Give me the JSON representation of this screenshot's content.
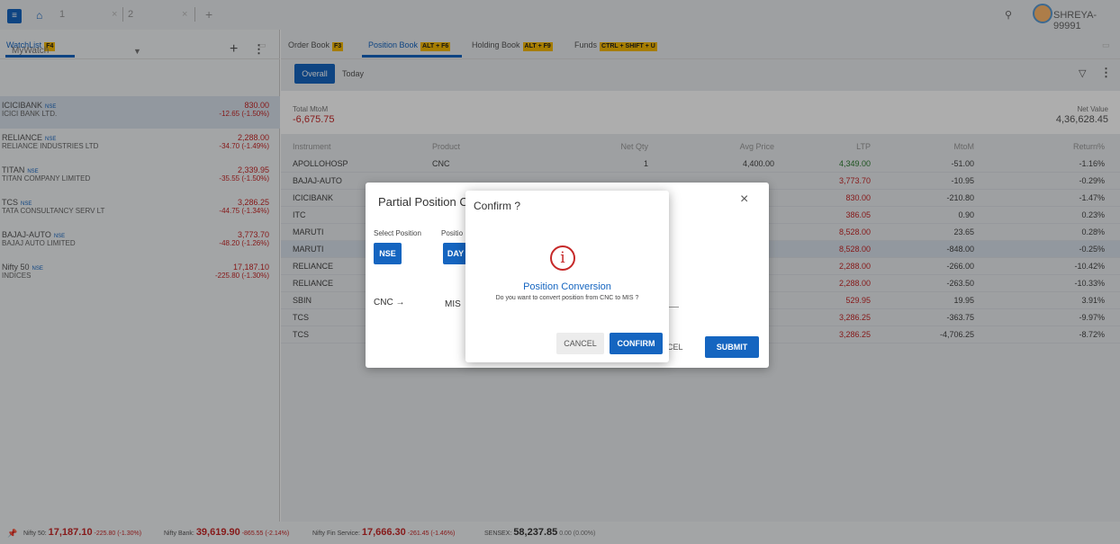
{
  "topbar": {
    "tabs": [
      "1",
      "2"
    ],
    "close": "×",
    "plus": "+",
    "user": "SHREYA-99991"
  },
  "watchlist": {
    "title": "WatchList",
    "badge": "F4",
    "name": "MyWatch",
    "plus": "+",
    "dots": "⋮",
    "items": [
      {
        "sym": "ICICIBANK",
        "ex": "NSE",
        "full": "ICICI BANK LTD.",
        "price": "830.00",
        "chg": "-12.65 (-1.50%)"
      },
      {
        "sym": "RELIANCE",
        "ex": "NSE",
        "full": "RELIANCE INDUSTRIES LTD",
        "price": "2,288.00",
        "chg": "-34.70 (-1.49%)"
      },
      {
        "sym": "TITAN",
        "ex": "NSE",
        "full": "TITAN COMPANY LIMITED",
        "price": "2,339.95",
        "chg": "-35.55 (-1.50%)"
      },
      {
        "sym": "TCS",
        "ex": "NSE",
        "full": "TATA CONSULTANCY SERV LT",
        "price": "3,286.25",
        "chg": "-44.75 (-1.34%)"
      },
      {
        "sym": "BAJAJ-AUTO",
        "ex": "NSE",
        "full": "BAJAJ AUTO LIMITED",
        "price": "3,773.70",
        "chg": "-48.20 (-1.26%)"
      },
      {
        "sym": "Nifty 50",
        "ex": "NSE",
        "full": "INDICES",
        "price": "17,187.10",
        "chg": "-225.80 (-1.30%)"
      }
    ]
  },
  "tabs": [
    {
      "label": "Order Book",
      "badge": "F3"
    },
    {
      "label": "Position Book",
      "badge": "ALT + F6"
    },
    {
      "label": "Holding Book",
      "badge": "ALT + F9"
    },
    {
      "label": "Funds",
      "badge": "CTRL + SHIFT + U"
    }
  ],
  "filters": {
    "overall": "Overall",
    "today": "Today"
  },
  "summary": {
    "mtm_label": "Total MtoM",
    "mtm_value": "-6,675.75",
    "nv_label": "Net Value",
    "nv_value": "4,36,628.45"
  },
  "table": {
    "headers": [
      "Instrument",
      "Product",
      "Net Qty",
      "Avg Price",
      "LTP",
      "MtoM",
      "Return%"
    ],
    "rows": [
      [
        "APOLLOHOSP",
        "CNC",
        "1",
        "4,400.00",
        "4,349.00",
        "-51.00",
        "-1.16%"
      ],
      [
        "BAJAJ-AUTO",
        "",
        "",
        "",
        "3,773.70",
        "-10.95",
        "-0.29%"
      ],
      [
        "ICICIBANK",
        "",
        "",
        "",
        "830.00",
        "-210.80",
        "-1.47%"
      ],
      [
        "ITC",
        "",
        "",
        "",
        "386.05",
        "0.90",
        "0.23%"
      ],
      [
        "MARUTI",
        "",
        "",
        "",
        "8,528.00",
        "23.65",
        "0.28%"
      ],
      [
        "MARUTI",
        "",
        "",
        "",
        "8,528.00",
        "-848.00",
        "-0.25%"
      ],
      [
        "RELIANCE",
        "",
        "",
        "",
        "2,288.00",
        "-266.00",
        "-10.42%"
      ],
      [
        "RELIANCE",
        "",
        "",
        "",
        "2,288.00",
        "-263.50",
        "-10.33%"
      ],
      [
        "SBIN",
        "",
        "",
        "",
        "529.95",
        "19.95",
        "3.91%"
      ],
      [
        "TCS",
        "",
        "",
        "",
        "3,286.25",
        "-363.75",
        "-9.97%"
      ],
      [
        "TCS",
        "",
        "",
        "",
        "3,286.25",
        "-4,706.25",
        "-8.72%"
      ]
    ]
  },
  "footer": [
    {
      "name": "Nifty 50:",
      "value": "17,187.10",
      "chg": "-225.80 (-1.30%)"
    },
    {
      "name": "Nifty Bank:",
      "value": "39,619.90",
      "chg": "-865.55 (-2.14%)"
    },
    {
      "name": "Nifty Fin Service:",
      "value": "17,666.30",
      "chg": "-261.45 (-1.46%)"
    },
    {
      "name": "SENSEX:",
      "value": "58,237.85",
      "chg": "0.00 (0.00%)"
    }
  ],
  "partial": {
    "title": "Partial Position C",
    "close": "×",
    "select_position": "Select Position",
    "position": "Positio",
    "nse": "NSE",
    "day": "DAY",
    "cnc": "CNC →",
    "mis": "MIS",
    "cancel": "CEL",
    "submit": "SUBMIT"
  },
  "confirm": {
    "title": "Confirm ?",
    "icon": "i",
    "heading": "Position Conversion",
    "message": "Do you want to convert position from CNC to MIS ?",
    "cancel": "CANCEL",
    "confirm": "CONFIRM"
  }
}
